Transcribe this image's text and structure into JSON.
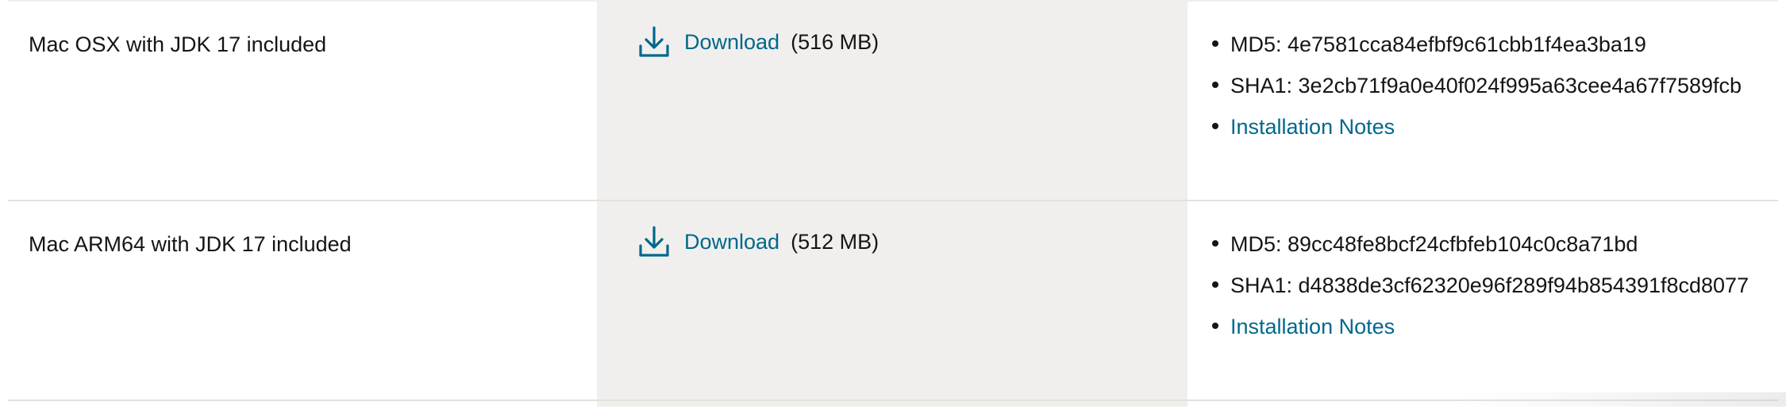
{
  "rows": [
    {
      "name": "Mac OSX with JDK 17 included",
      "download_label": "Download",
      "size": "(516 MB)",
      "md5": "MD5: 4e7581cca84efbf9c61cbb1f4ea3ba19",
      "sha1": "SHA1: 3e2cb71f9a0e40f024f995a63cee4a67f7589fcb",
      "notes_label": "Installation Notes"
    },
    {
      "name": "Mac ARM64 with JDK 17 included",
      "download_label": "Download",
      "size": "(512 MB)",
      "md5": "MD5: 89cc48fe8bcf24cfbfeb104c0c8a71bd",
      "sha1": "SHA1: d4838de3cf62320e96f289f94b854391f8cd8077",
      "notes_label": "Installation Notes"
    }
  ],
  "icons": {
    "download": "download-icon"
  },
  "colors": {
    "link": "#00688c",
    "text": "#161513",
    "column_shade": "#f1efed",
    "divider": "#e4e1dd"
  }
}
